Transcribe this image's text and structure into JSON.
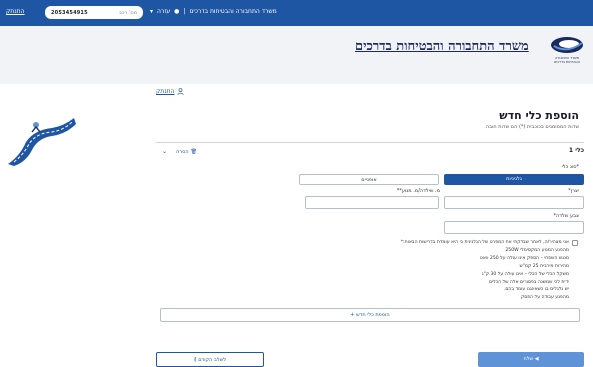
{
  "topbar": {
    "logout": "התנתק",
    "search_placeholder": "מס' רכב",
    "search_value": "2053454915",
    "nav_ministry": "משרד התחבורה והבטיחות בדרכים",
    "nav_help": "עזרה"
  },
  "header": {
    "logo_title": "משרד התחבורה והבטיחות בדרכים",
    "logo_small_line1": "משרד התחבורה",
    "logo_small_line2": "והבטיחות בדרכים"
  },
  "user": {
    "link": "התנתק"
  },
  "page": {
    "title": "הוספת כלי חדש",
    "subtitle": "שדות המסומנים בכוכבית (*) הם שדות חובה"
  },
  "card": {
    "vehicle_title": "כלי 1",
    "remove_label": "הסרה",
    "type_label": "סוג כלי*",
    "type_options": [
      "גלגיניות",
      "אופניים"
    ],
    "fields": {
      "manufacturer_label": "יצרן*",
      "frame_label": "מ. שילדה/מ. מנוע**",
      "color_label": "צבע שלדה*"
    },
    "agreement": {
      "header": "אני מצהיר/ה, לאחר שבדקתי את המפרט של הגלגינית כי היא עומדת בדרישות הבאות:*",
      "lines": [
        "מהפנע המנוע המקסימלי 250W",
        "מנגש השפחי – הספק אינו עולה על 250 וואט",
        "מהירות מירבית 25 קמ\"ש",
        "משקל הכלי של הכלי – אינו עולה על 30 ק\"ג",
        "ידית לכי שמשנה בפסורים אלה של הכלים",
        "יש גלגלים בו כשאינגנו עומד בהם.",
        "מהפנע עבודה על הפסק"
      ]
    },
    "add_vehicle": "+ הוספת כלי חדש"
  },
  "actions": {
    "back": "⟪ לשלב הקודם",
    "next": "שלח ◀"
  }
}
